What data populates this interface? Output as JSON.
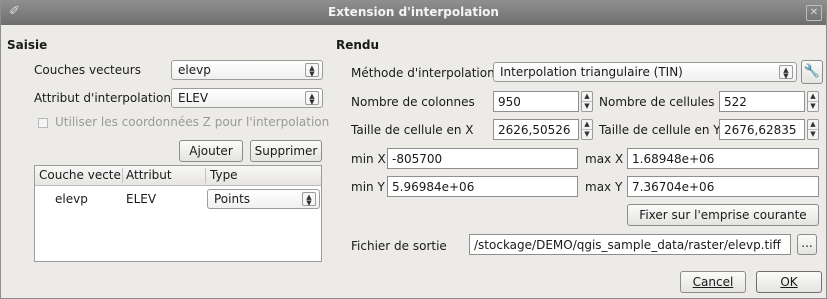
{
  "window": {
    "title": "Extension d'interpolation"
  },
  "saisie": {
    "title": "Saisie",
    "couches_label": "Couches vecteurs",
    "couches_value": "elevp",
    "attribut_label": "Attribut d'interpolation",
    "attribut_value": "ELEV",
    "use_z_label": "Utiliser les coordonnées Z pour l'interpolation",
    "ajouter_label": "Ajouter",
    "supprimer_label": "Supprimer",
    "table": {
      "headers": [
        "Couche vecte",
        "Attribut",
        "Type"
      ],
      "rows": [
        {
          "couche": "elevp",
          "attribut": "ELEV",
          "type": "Points"
        }
      ]
    }
  },
  "rendu": {
    "title": "Rendu",
    "methode_label": "Méthode d'interpolation",
    "methode_value": "Interpolation triangulaire (TIN)",
    "nb_colonnes_label": "Nombre de colonnes",
    "nb_colonnes_value": "950",
    "nb_cellules_label": "Nombre de cellules",
    "nb_cellules_value": "522",
    "taille_x_label": "Taille de cellule en X",
    "taille_x_value": "2626,50526",
    "taille_y_label": "Taille de cellule en Y",
    "taille_y_value": "2676,62835",
    "min_x_label": "min X",
    "min_x_value": "-805700",
    "max_x_label": "max X",
    "max_x_value": "1.68948e+06",
    "min_y_label": "min Y",
    "min_y_value": "5.96984e+06",
    "max_y_label": "max Y",
    "max_y_value": "7.36704e+06",
    "fixer_label": "Fixer sur l'emprise courante",
    "fichier_label": "Fichier de sortie",
    "fichier_value": "/stockage/DEMO/qgis_sample_data/raster/elevp.tiff",
    "browse_label": "..."
  },
  "buttons": {
    "cancel_label": "Cancel",
    "ok_label": "OK"
  },
  "icons": {
    "app": "brush-icon",
    "close": "close-icon",
    "settings": "wrench-icon"
  }
}
